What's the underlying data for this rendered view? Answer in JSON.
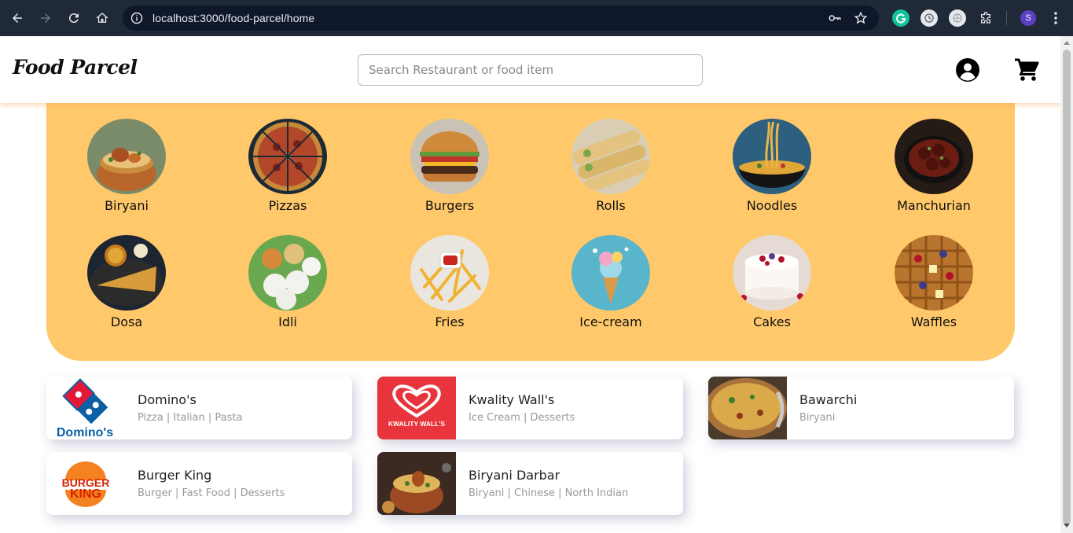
{
  "browser": {
    "url": "localhost:3000/food-parcel/home",
    "profile_initial": "S"
  },
  "header": {
    "logo": "Food Parcel",
    "search_placeholder": "Search Restaurant or food item"
  },
  "categories": [
    {
      "label": "Biryani"
    },
    {
      "label": "Pizzas"
    },
    {
      "label": "Burgers"
    },
    {
      "label": "Rolls"
    },
    {
      "label": "Noodles"
    },
    {
      "label": "Manchurian"
    },
    {
      "label": "Dosa"
    },
    {
      "label": "Idli"
    },
    {
      "label": "Fries"
    },
    {
      "label": "Ice-cream"
    },
    {
      "label": "Cakes"
    },
    {
      "label": "Waffles"
    }
  ],
  "restaurants": [
    {
      "name": "Domino's",
      "cuisine": "Pizza | Italian | Pasta"
    },
    {
      "name": "Kwality Wall's",
      "cuisine": "Ice Cream | Desserts"
    },
    {
      "name": "Bawarchi",
      "cuisine": "Biryani"
    },
    {
      "name": "Burger King",
      "cuisine": "Burger | Fast Food | Desserts"
    },
    {
      "name": "Biryani Darbar",
      "cuisine": "Biryani | Chinese | North Indian"
    }
  ],
  "logo_text": {
    "dominos": "Domino's",
    "kwality": "KWALITY WALL'S",
    "burger_king_1": "BURGER",
    "burger_king_2": "KING"
  },
  "colors": {
    "category_panel": "#ffc86b",
    "browser_chrome": "#1f2937",
    "kwality_red": "#e8343c",
    "dominos_blue": "#0b5fa5",
    "dominos_red": "#e31837",
    "burger_king_orange": "#f58220"
  }
}
